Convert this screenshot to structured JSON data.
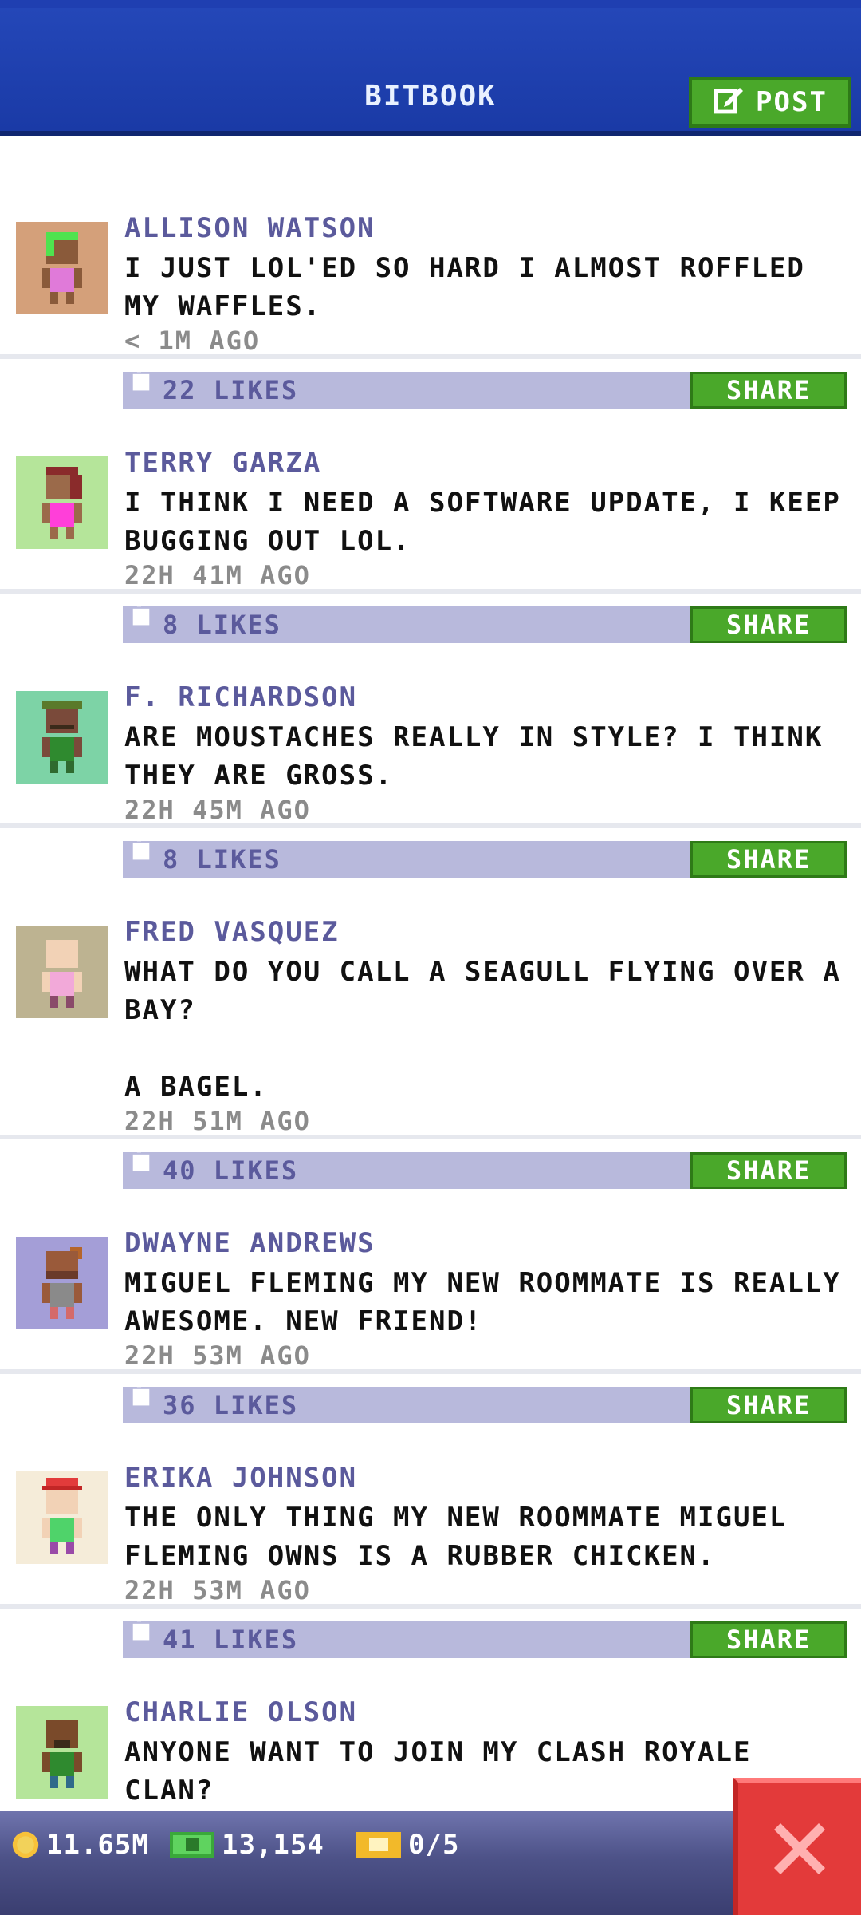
{
  "header": {
    "title": "BITBOOK",
    "post_label": "POST"
  },
  "posts": [
    {
      "name": "ALLISON WATSON",
      "message": "I JUST LOL'ED SO HARD I ALMOST ROFFLED MY WAFFLES.",
      "time": "< 1M AGO",
      "likes": "22 LIKES",
      "share": "SHARE",
      "avatar_bg": "#d4a07a"
    },
    {
      "name": "TERRY GARZA",
      "message": "I THINK I NEED A SOFTWARE UPDATE, I KEEP BUGGING OUT LOL.",
      "time": "22H 41M AGO",
      "likes": "8 LIKES",
      "share": "SHARE",
      "avatar_bg": "#b5e59a"
    },
    {
      "name": "F. RICHARDSON",
      "message": "ARE MOUSTACHES REALLY IN STYLE? I THINK THEY ARE GROSS.",
      "time": "22H 45M AGO",
      "likes": "8 LIKES",
      "share": "SHARE",
      "avatar_bg": "#7dd3a6"
    },
    {
      "name": "FRED VASQUEZ",
      "message": "WHAT DO YOU CALL A SEAGULL FLYING OVER A BAY?\n\nA BAGEL.",
      "time": "22H 51M AGO",
      "likes": "40 LIKES",
      "share": "SHARE",
      "avatar_bg": "#bdb391"
    },
    {
      "name": "DWAYNE ANDREWS",
      "message": "MIGUEL FLEMING MY NEW ROOMMATE IS REALLY AWESOME. NEW FRIEND!",
      "time": "22H 53M AGO",
      "likes": "36 LIKES",
      "share": "SHARE",
      "avatar_bg": "#a49ed7"
    },
    {
      "name": "ERIKA JOHNSON",
      "message": "THE ONLY THING MY NEW ROOMMATE MIGUEL FLEMING OWNS IS A RUBBER CHICKEN.",
      "time": "22H 53M AGO",
      "likes": "41 LIKES",
      "share": "SHARE",
      "avatar_bg": "#f5ecd9"
    },
    {
      "name": "CHARLIE OLSON",
      "message": "ANYONE WANT TO JOIN MY CLASH ROYALE CLAN?",
      "time": "",
      "likes": "",
      "share": "",
      "avatar_bg": "#b5e59a"
    }
  ],
  "bottombar": {
    "coins": "11.65M",
    "bux": "13,154",
    "tickets": "0/5"
  },
  "colors": {
    "header_blue": "#2447b8",
    "green": "#4aa82a",
    "like_bar": "#b8b9dc",
    "name_purple": "#5b5a9c",
    "close_red": "#e33a3a"
  },
  "icons": [
    "post-edit-icon",
    "like-icon",
    "coin-icon",
    "bux-icon",
    "ticket-icon",
    "close-icon"
  ]
}
